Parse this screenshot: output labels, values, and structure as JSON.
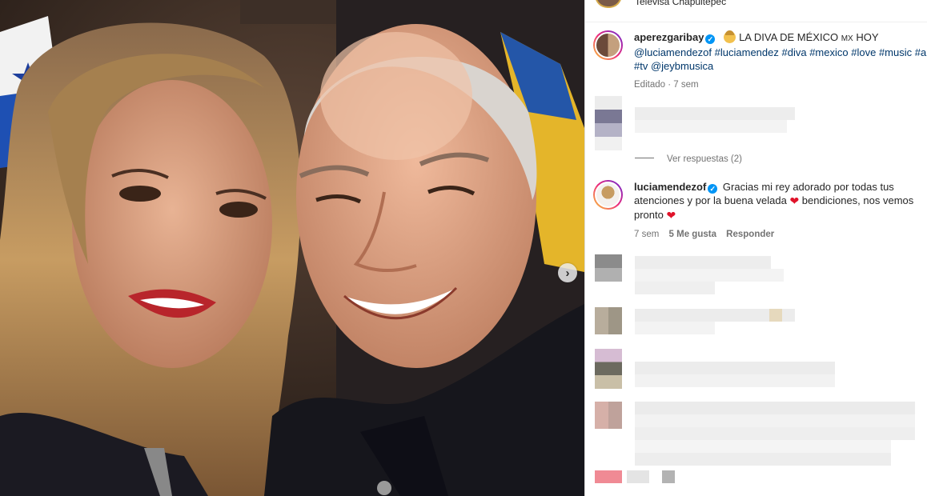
{
  "post": {
    "location": "Televisa Chapultepec",
    "caption": {
      "username": "aperezgaribay",
      "text_before": "LA DIVA DE MÉXICO",
      "flag_text": "MX",
      "text_after": "HOY",
      "mention": "@luciamendezof",
      "hashtags": [
        "#luciamendez",
        "#diva",
        "#mexico",
        "#love",
        "#music",
        "#ar",
        "#tv"
      ],
      "mention2": "@jeybmusica",
      "edited_label": "Editado",
      "time": "7 sem"
    }
  },
  "view_replies": "Ver respuestas (2)",
  "reply_comment": {
    "username": "luciamendezof",
    "text_part1": "Gracias mi rey adorado por todas tus atenciones y por la buena velada",
    "text_part2": "bendiciones, nos vemos pronto",
    "time": "7 sem",
    "likes": "5 Me gusta",
    "reply_label": "Responder"
  },
  "colors": {
    "link": "#00376b",
    "verified": "#0095f6",
    "meta": "#737373",
    "heart": "#e0132a"
  },
  "icons": {
    "next": "chevron-right-icon",
    "verified": "verified-badge-icon",
    "heart": "red-heart-icon"
  }
}
